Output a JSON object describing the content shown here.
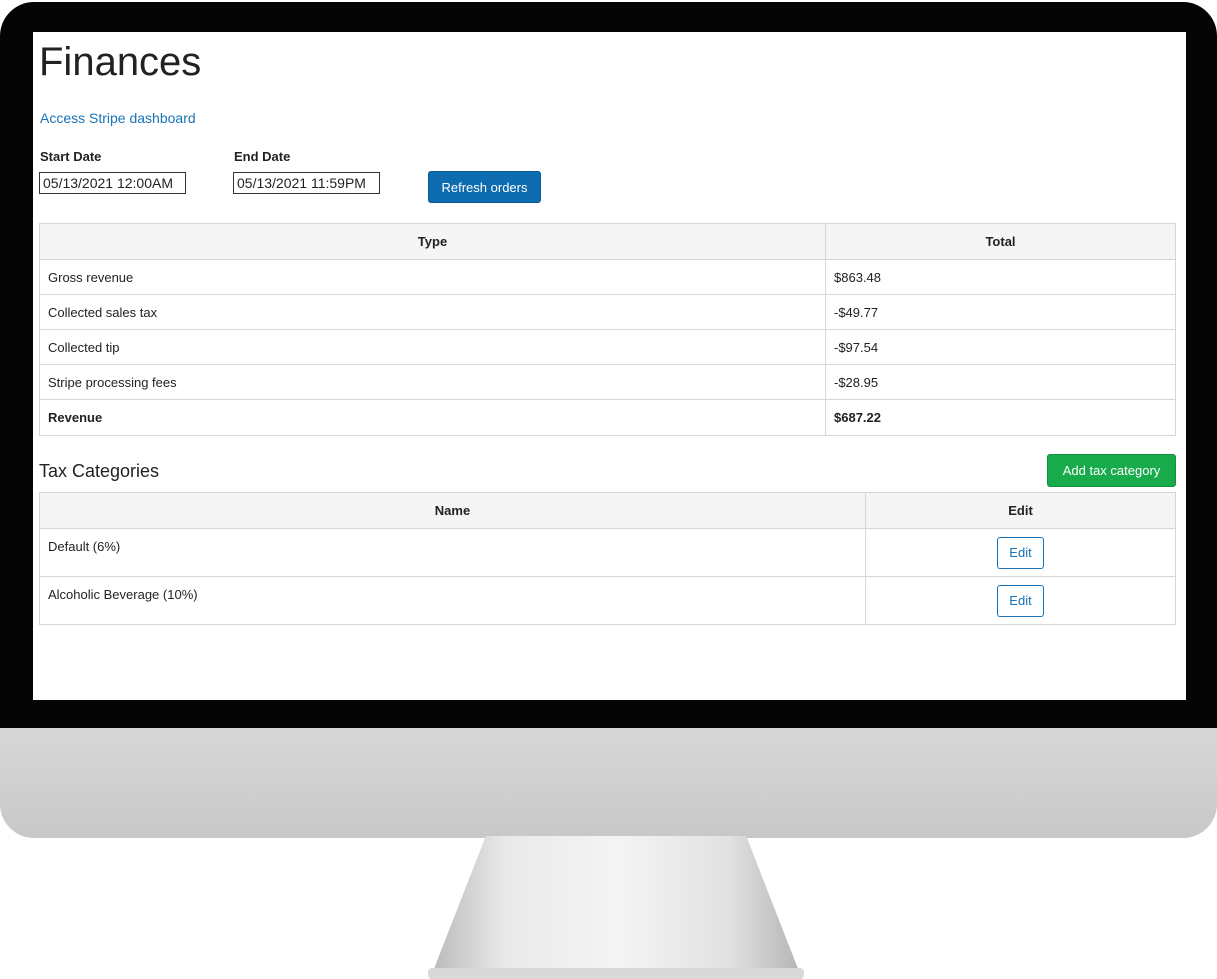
{
  "page": {
    "title": "Finances",
    "stripe_link": "Access Stripe dashboard"
  },
  "filters": {
    "start_label": "Start Date",
    "start_value": "05/13/2021 12:00AM",
    "end_label": "End Date",
    "end_value": "05/13/2021 11:59PM",
    "refresh_label": "Refresh orders"
  },
  "finance_table": {
    "headers": [
      "Type",
      "Total"
    ],
    "rows": [
      {
        "type": "Gross revenue",
        "total": "$863.48"
      },
      {
        "type": "Collected sales tax",
        "total": "-$49.77"
      },
      {
        "type": "Collected tip",
        "total": "-$97.54"
      },
      {
        "type": "Stripe processing fees",
        "total": "-$28.95"
      },
      {
        "type": "Revenue",
        "total": "$687.22"
      }
    ]
  },
  "tax_section": {
    "title": "Tax Categories",
    "add_label": "Add tax category",
    "headers": [
      "Name",
      "Edit"
    ],
    "rows": [
      {
        "name": "Default (6%)",
        "edit_label": "Edit"
      },
      {
        "name": "Alcoholic Beverage (10%)",
        "edit_label": "Edit"
      }
    ]
  },
  "colors": {
    "primary": "#0d6bb0",
    "success": "#17ab4b",
    "link": "#1a73b4"
  }
}
